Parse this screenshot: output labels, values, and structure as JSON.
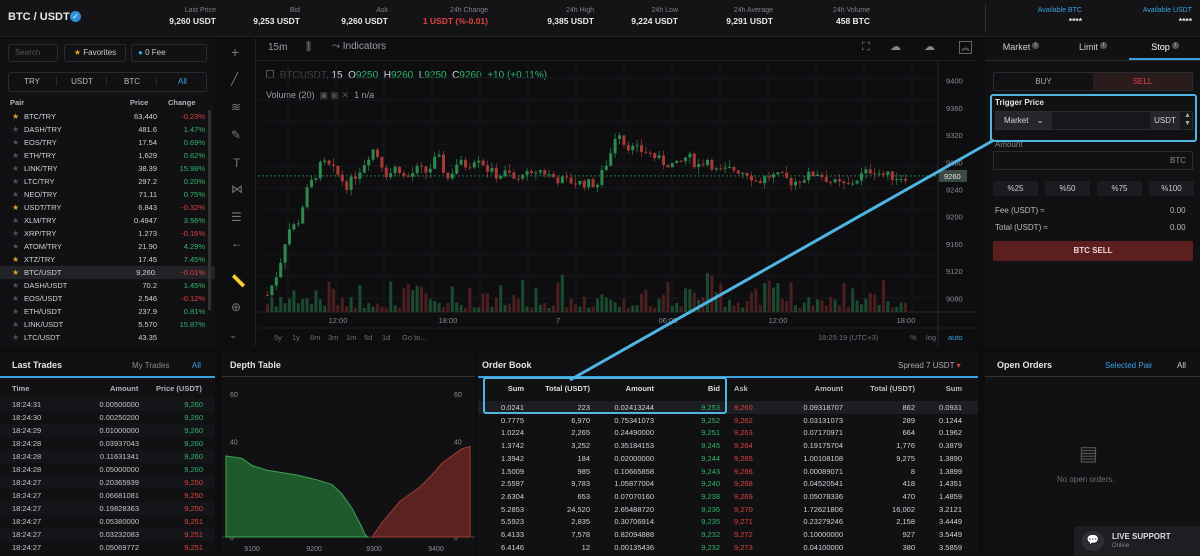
{
  "header": {
    "pair": "BTC / USDT",
    "stats": [
      {
        "label": "Last Price",
        "value": "9,260 USDT"
      },
      {
        "label": "Bid",
        "value": "9,253 USDT"
      },
      {
        "label": "Ask",
        "value": "9,260 USDT"
      },
      {
        "label": "24h Change",
        "value": "1 USDT (%-0.01)"
      },
      {
        "label": "24h High",
        "value": "9,385 USDT"
      },
      {
        "label": "24h Low",
        "value": "9,224 USDT"
      },
      {
        "label": "24h Average",
        "value": "9,291 USDT"
      },
      {
        "label": "24h Volume",
        "value": "458 BTC"
      }
    ],
    "available_btc_label": "Available BTC",
    "available_btc": "****",
    "available_usdt_label": "Available USDT",
    "available_usdt": "****"
  },
  "markets": {
    "search_placeholder": "Search",
    "favorites": "Favorites",
    "zero_fee": "0 Fee",
    "tabs": [
      "TRY",
      "USDT",
      "BTC",
      "All"
    ],
    "columns": [
      "Pair",
      "Price",
      "Change"
    ],
    "rows": [
      {
        "pair": "BTC/TRY",
        "price": "63,440",
        "change": "-0.23%",
        "up": false,
        "fav": true
      },
      {
        "pair": "DASH/TRY",
        "price": "481.6",
        "change": "1.47%",
        "up": true,
        "fav": false
      },
      {
        "pair": "EOS/TRY",
        "price": "17.54",
        "change": "0.69%",
        "up": true,
        "fav": false
      },
      {
        "pair": "ETH/TRY",
        "price": "1,629",
        "change": "0.62%",
        "up": true,
        "fav": false
      },
      {
        "pair": "LINK/TRY",
        "price": "38.39",
        "change": "15.98%",
        "up": true,
        "fav": false
      },
      {
        "pair": "LTC/TRY",
        "price": "297.2",
        "change": "0.20%",
        "up": true,
        "fav": false
      },
      {
        "pair": "NEO/TRY",
        "price": "71.11",
        "change": "0.75%",
        "up": true,
        "fav": false
      },
      {
        "pair": "USDT/TRY",
        "price": "6.843",
        "change": "-0.32%",
        "up": false,
        "fav": true
      },
      {
        "pair": "XLM/TRY",
        "price": "0.4947",
        "change": "3.56%",
        "up": true,
        "fav": false
      },
      {
        "pair": "XRP/TRY",
        "price": "1.273",
        "change": "-0.16%",
        "up": false,
        "fav": false
      },
      {
        "pair": "ATOM/TRY",
        "price": "21.90",
        "change": "4.29%",
        "up": true,
        "fav": false
      },
      {
        "pair": "XTZ/TRY",
        "price": "17.45",
        "change": "7.45%",
        "up": true,
        "fav": true
      },
      {
        "pair": "BTC/USDT",
        "price": "9,260.",
        "change": "-0.01%",
        "up": false,
        "fav": true
      },
      {
        "pair": "DASH/USDT",
        "price": "70.2",
        "change": "1.45%",
        "up": true,
        "fav": false
      },
      {
        "pair": "EOS/USDT",
        "price": "2.546",
        "change": "-0.12%",
        "up": false,
        "fav": false
      },
      {
        "pair": "ETH/USDT",
        "price": "237.9",
        "change": "0.81%",
        "up": true,
        "fav": false
      },
      {
        "pair": "LINK/USDT",
        "price": "5.570",
        "change": "15.87%",
        "up": true,
        "fav": false
      },
      {
        "pair": "LTC/USDT",
        "price": "43.35",
        "change": "",
        "up": true,
        "fav": false
      }
    ]
  },
  "chart": {
    "timeframes": [
      "15m"
    ],
    "indicators": "Indicators",
    "symbol": "BTCUSDT",
    "interval": "15",
    "ohlc": {
      "o": "9250",
      "h": "9260",
      "l": "9250",
      "c": "9260",
      "chg": "+10 (+0.11%)"
    },
    "volume": "Volume (20)",
    "volume_val": "1  n/a",
    "price_axis": [
      "9400",
      "9360",
      "9320",
      "9280",
      "9240",
      "9200",
      "9160",
      "9120",
      "9080"
    ],
    "last_price_tag": "9260",
    "time_axis": [
      "12:00",
      "18:00",
      "7",
      "06:00",
      "12:00",
      "18:00",
      "19:00"
    ],
    "ranges": [
      "5y",
      "1y",
      "6m",
      "3m",
      "1m",
      "5d",
      "1d",
      "Go to..."
    ],
    "clock": "18:25:19 (UTC+3)",
    "pct": "%",
    "log": "log",
    "auto": "auto"
  },
  "order_form": {
    "tabs": [
      "Market",
      "Limit",
      "Stop"
    ],
    "buy": "BUY",
    "sell": "SELL",
    "trigger_label": "Trigger Price",
    "trigger_type": "Market",
    "trigger_unit": "USDT",
    "amount_label": "Amount",
    "amount_unit": "BTC",
    "percents": [
      "%25",
      "%50",
      "%75",
      "%100"
    ],
    "fee_label": "Fee (USDT) ≈",
    "fee_val": "0.00",
    "total_label": "Total (USDT) ≈",
    "total_val": "0.00",
    "submit": "BTC SELL"
  },
  "last_trades": {
    "title": "Last Trades",
    "my_trades": "My Trades",
    "all": "All",
    "columns": [
      "Time",
      "Amount",
      "Price (USDT)"
    ],
    "rows": [
      [
        "18:24:31",
        "0.00500000",
        "9,260",
        true
      ],
      [
        "18:24:30",
        "0.00250200",
        "9,260",
        true
      ],
      [
        "18:24:29",
        "0.01000000",
        "9,260",
        true
      ],
      [
        "18:24:28",
        "0.03937043",
        "9,260",
        true
      ],
      [
        "18:24:28",
        "0.11631341",
        "9,260",
        true
      ],
      [
        "18:24:28",
        "0.05000000",
        "9,260",
        true
      ],
      [
        "18:24:27",
        "0.20365939",
        "9,250",
        false
      ],
      [
        "18:24:27",
        "0.06681081",
        "9,250",
        false
      ],
      [
        "18:24:27",
        "0.19828363",
        "9,250",
        false
      ],
      [
        "18:24:27",
        "0.05380000",
        "9,251",
        false
      ],
      [
        "18:24:27",
        "0.03232083",
        "9,251",
        false
      ],
      [
        "18:24:27",
        "0.05069772",
        "9,251",
        false
      ]
    ]
  },
  "depth": {
    "title": "Depth Table",
    "y_labels": [
      "60",
      "40",
      "20",
      "0"
    ],
    "x_labels": [
      "9100",
      "9200",
      "9300",
      "9400"
    ]
  },
  "order_book": {
    "title": "Order Book",
    "spread": "Spread 7 USDT",
    "bid_columns": [
      "Sum",
      "Total (USDT)",
      "Amount",
      "Bid"
    ],
    "ask_columns": [
      "Ask",
      "Amount",
      "Total (USDT)",
      "Sum"
    ],
    "bids": [
      [
        "0.0241",
        "223",
        "0.02413244",
        "9,253"
      ],
      [
        "0.7775",
        "6,970",
        "0.75341073",
        "9,252"
      ],
      [
        "1.0224",
        "2,265",
        "0.24490000",
        "9,251"
      ],
      [
        "1.3742",
        "3,252",
        "0.35184153",
        "9,245"
      ],
      [
        "1.3942",
        "184",
        "0.02000000",
        "9,244"
      ],
      [
        "1.5009",
        "985",
        "0.10665858",
        "9,243"
      ],
      [
        "2.5597",
        "9,783",
        "1.05877004",
        "9,240"
      ],
      [
        "2.6304",
        "653",
        "0.07070160",
        "9,238"
      ],
      [
        "5.2853",
        "24,520",
        "2.65488720",
        "9,236"
      ],
      [
        "5.5923",
        "2,835",
        "0.30706914",
        "9,235"
      ],
      [
        "6.4133",
        "7,578",
        "0.82094888",
        "9,232"
      ],
      [
        "6.4146",
        "12",
        "0.00135436",
        "9,232"
      ]
    ],
    "asks": [
      [
        "9,260",
        "0.09318707",
        "862",
        "0.0931"
      ],
      [
        "9,262",
        "0.03131073",
        "289",
        "0.1244"
      ],
      [
        "9,263",
        "0.07170971",
        "664",
        "0.1962"
      ],
      [
        "9,264",
        "0.19175704",
        "1,776",
        "0.3879"
      ],
      [
        "9,265",
        "1.00108108",
        "9,275",
        "1.3890"
      ],
      [
        "9,266",
        "0.00089071",
        "8",
        "1.3899"
      ],
      [
        "9,268",
        "0.04520541",
        "418",
        "1.4351"
      ],
      [
        "9,269",
        "0.05078336",
        "470",
        "1.4859"
      ],
      [
        "9,270",
        "1.72621806",
        "16,002",
        "3.2121"
      ],
      [
        "9,271",
        "0.23279246",
        "2,158",
        "3.4449"
      ],
      [
        "9,272",
        "0.10000000",
        "927",
        "3.5449"
      ],
      [
        "9,273",
        "0.04100000",
        "380",
        "3.5859"
      ]
    ]
  },
  "open_orders": {
    "title": "Open Orders",
    "selected": "Selected Pair",
    "all": "All",
    "empty": "No open orders."
  },
  "support": {
    "title": "LIVE SUPPORT",
    "status": "Online"
  }
}
